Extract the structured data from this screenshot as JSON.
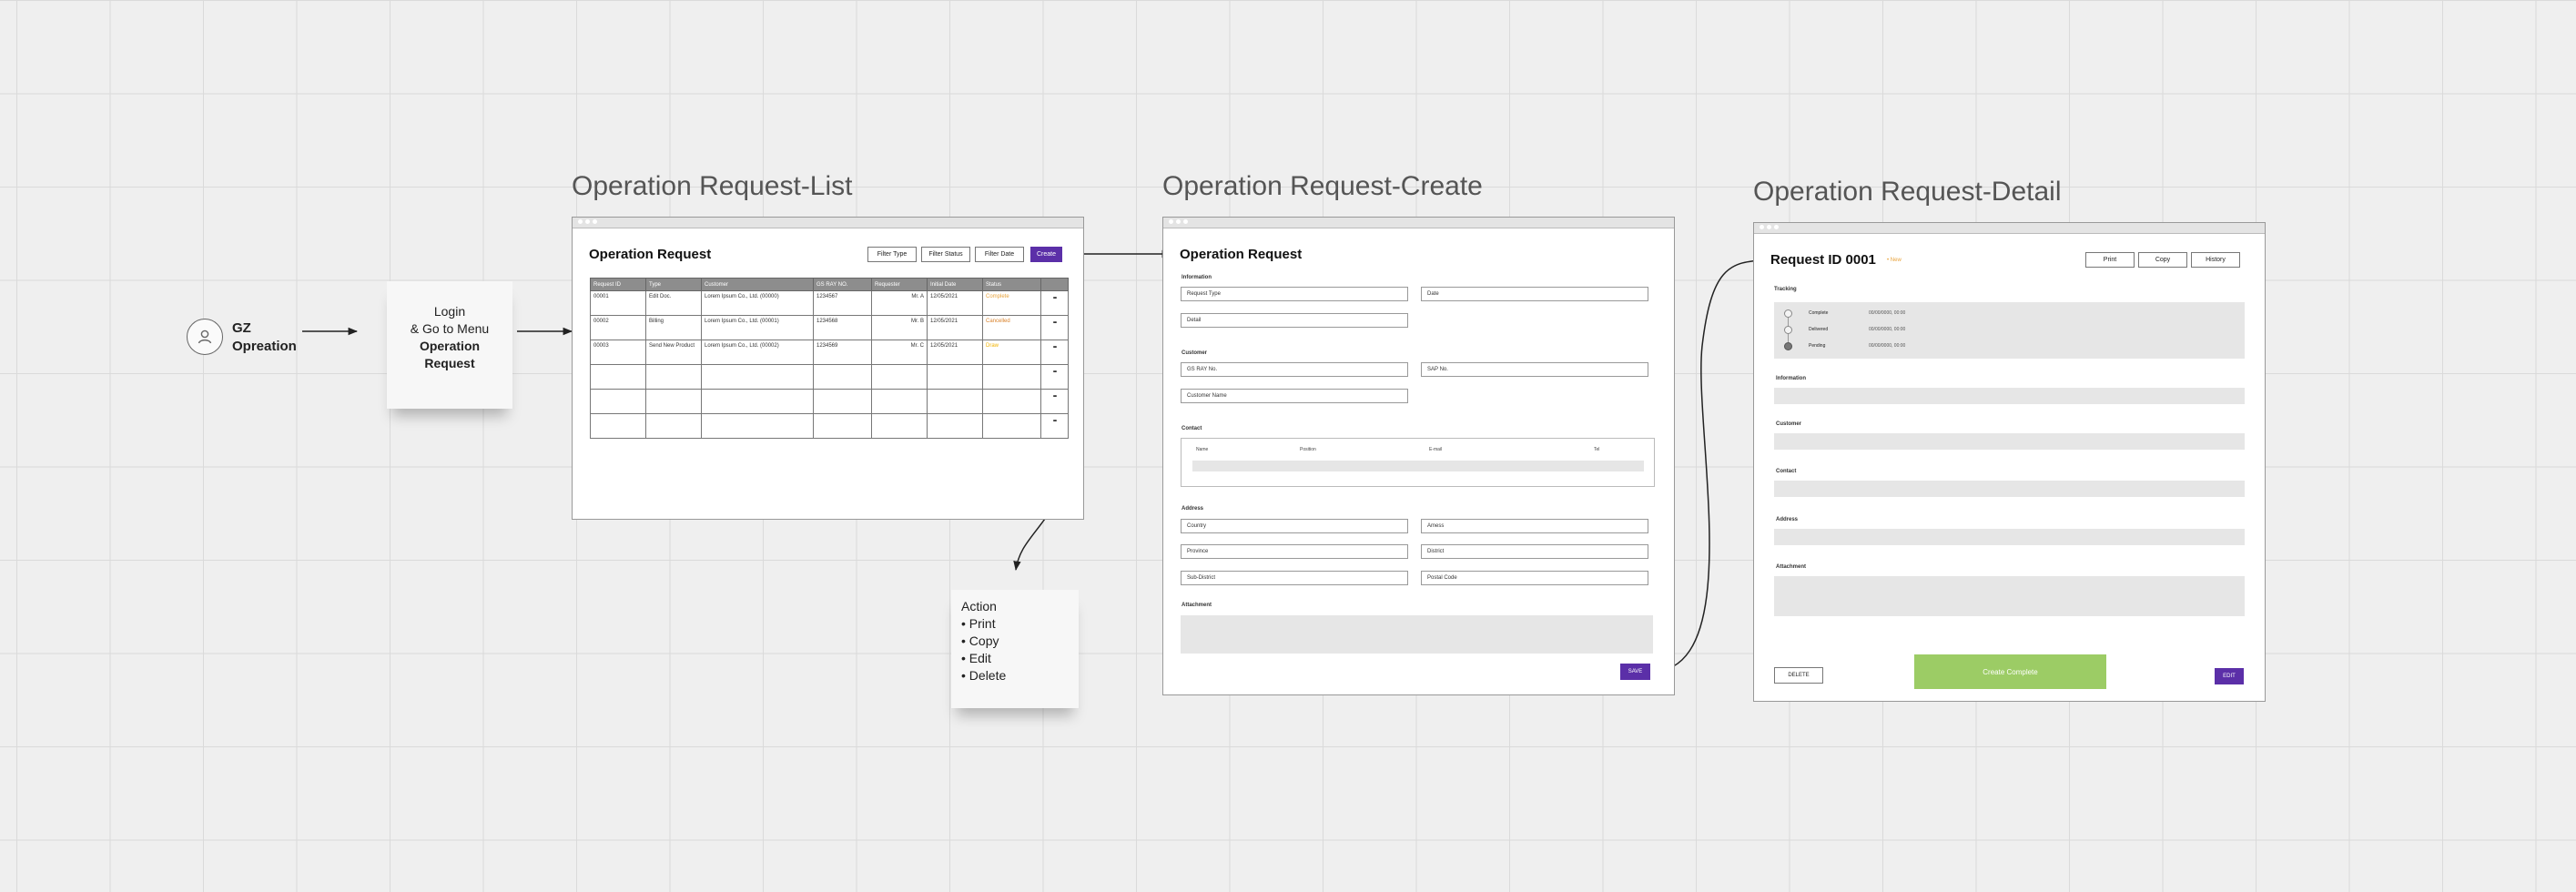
{
  "start": {
    "line1": "GZ",
    "line2": "Opreation"
  },
  "login_note": {
    "l1": "Login",
    "l2": "& Go to Menu",
    "l3": "Operation",
    "l4": "Request"
  },
  "action_note": {
    "title": "Action",
    "items": [
      "• Print",
      "• Copy",
      "• Edit",
      "• Delete"
    ]
  },
  "list": {
    "frame_title": "Operation Request-List",
    "page_title": "Operation Request",
    "buttons": [
      "Filter Type",
      "Filter Status",
      "Filter Date",
      "Create"
    ],
    "columns": [
      "Request ID",
      "Type",
      "Customer",
      "GS RAY NO.",
      "Requester",
      "Initial Date",
      "Status",
      ""
    ],
    "rows": [
      [
        "00001",
        "Edit Doc.",
        "Lorem Ipsum Co., Ltd. (00000)",
        "1234567",
        "Mr. A",
        "12/05/2021",
        "Complete"
      ],
      [
        "00002",
        "Billing",
        "Lorem Ipsum Co., Ltd. (00001)",
        "1234568",
        "Mr. B",
        "12/05/2021",
        "Cancelled"
      ],
      [
        "00003",
        "Send New Product",
        "Lorem Ipsum Co., Ltd. (00002)",
        "1234569",
        "Mr. C",
        "12/05/2021",
        "Draw"
      ],
      [
        "",
        "",
        "",
        "",
        "",
        "",
        ""
      ],
      [
        "",
        "",
        "",
        "",
        "",
        "",
        ""
      ],
      [
        "",
        "",
        "",
        "",
        "",
        "",
        ""
      ]
    ],
    "more_label": "•••",
    "status_colors": {
      "Complete": "#e8a33c",
      "Cancelled": "#d9822b",
      "Draw": "#f2b300"
    }
  },
  "create": {
    "frame_title": "Operation Request-Create",
    "page_title": "Operation Request",
    "sections": {
      "information": "Information",
      "customer": "Customer",
      "contact": "Contact",
      "address": "Address",
      "attachment": "Attachment"
    },
    "fields": {
      "request_type": "Request Type",
      "date": "Date",
      "detail": "Detail",
      "gs_ray_no": "GS RAY No.",
      "sap_no": "SAP No.",
      "customer_name": "Customer Name",
      "country": "Country",
      "amess": "Amess",
      "province": "Province",
      "district": "District",
      "sub_district": "Sub-District",
      "postal_code": "Postal Code"
    },
    "contact_columns": [
      "Name",
      "Position",
      "E-mail",
      "Tel"
    ],
    "save": "SAVE"
  },
  "detail": {
    "frame_title": "Operation Request-Detail",
    "page_title": "Request ID 0001",
    "badge": "• New",
    "buttons": [
      "Print",
      "Copy",
      "History"
    ],
    "tracking_label": "Tracking",
    "tracking": [
      {
        "label": "Complete",
        "time": "00/00/0000, 00:00"
      },
      {
        "label": "Delivered",
        "time": "00/00/0000, 00:00"
      },
      {
        "label": "Pending",
        "time": "00/00/0000, 00:00"
      }
    ],
    "sections": [
      "Information",
      "Customer",
      "Contact",
      "Address",
      "Attachment"
    ],
    "delete": "DELETE",
    "complete": "Create Complete",
    "edit": "EDIT",
    "complete_color": "#9ccc65",
    "accent": "#5b2fa8"
  }
}
